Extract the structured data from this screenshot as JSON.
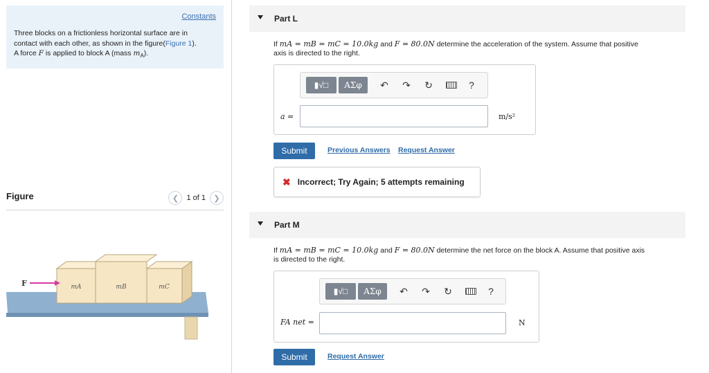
{
  "left": {
    "constants_link": "Constants",
    "problem_line1": "Three blocks on a frictionless horizontal surface are in",
    "problem_line2a": "contact with each other, as shown in the figure(",
    "problem_figure_link": "Figure 1",
    "problem_line2b": ").",
    "problem_line3a": "A force ",
    "problem_force_symbol": "F",
    "problem_line3b": " is applied to block A (mass ",
    "problem_mass_symbol": "m",
    "problem_mass_sub": "A",
    "problem_line3c": ").",
    "figure_label": "Figure",
    "pager_text": "1 of 1",
    "figure": {
      "force_label": "F",
      "block_a_label": "mA",
      "block_b_label": "mB",
      "block_c_label": "mC"
    }
  },
  "part_l": {
    "title": "Part L",
    "question_line1a": "If ",
    "question_math": "mA = mB = mC = 10.0kg",
    "question_and": " and ",
    "question_force": "F = 80.0N",
    "question_line1b": " determine the acceleration of the system. Assume that positive",
    "question_line2": "axis is directed to the right.",
    "var_label": "a =",
    "input_value": "",
    "unit": "m/s²",
    "greek_btn": "ΑΣφ",
    "help_btn": "?",
    "submit_label": "Submit",
    "previous_answers": "Previous Answers",
    "request_answer": "Request Answer",
    "feedback": "Incorrect; Try Again; 5 attempts remaining"
  },
  "part_m": {
    "title": "Part M",
    "question_line1a": "If ",
    "question_math": "mA = mB = mC = 10.0kg",
    "question_and": " and ",
    "question_force": "F = 80.0N",
    "question_line1b": " determine the net force on the block A. Assume that positive axis",
    "question_line2": "is directed to the right.",
    "var_label": "FA net =",
    "input_value": "",
    "unit": "N",
    "greek_btn": "ΑΣφ",
    "help_btn": "?",
    "submit_label": "Submit",
    "request_answer": "Request Answer"
  },
  "colors": {
    "link": "#2f6ca8",
    "submit": "#2f6ca8",
    "constants_bg": "#eaf2f9",
    "error": "#d42a2a",
    "block": "#f6e6c4",
    "table": "#8fb0cf"
  }
}
